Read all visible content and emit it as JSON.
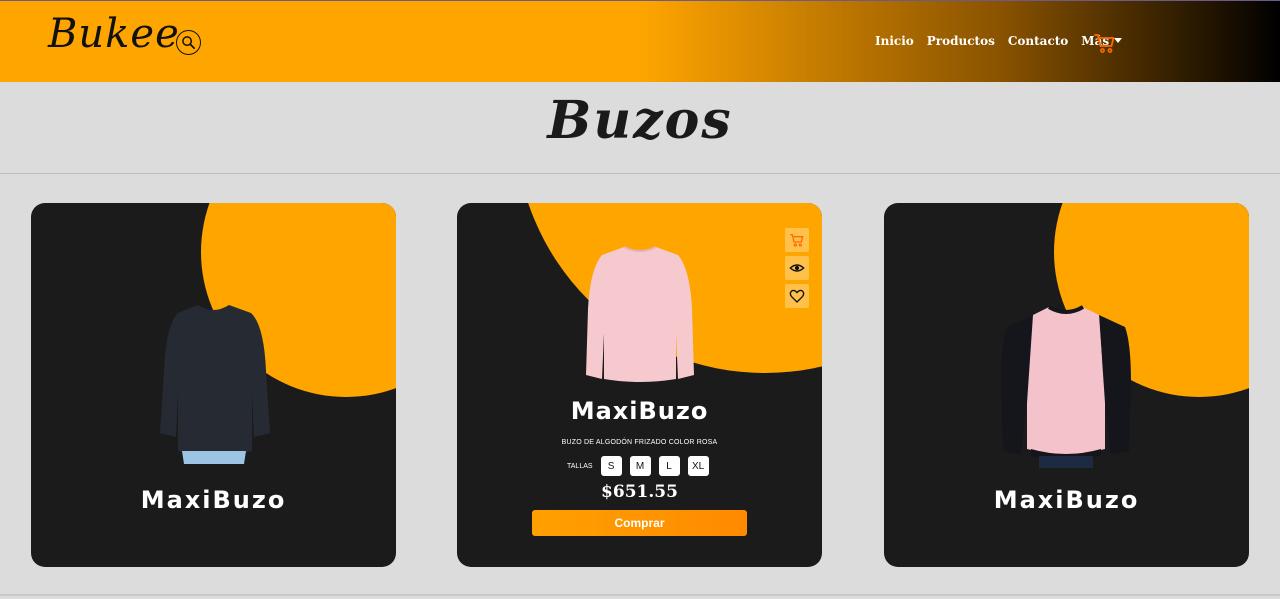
{
  "brand": {
    "logo": "Bukee"
  },
  "nav": {
    "links": [
      "Inicio",
      "Productos",
      "Contacto"
    ],
    "more_label": "Más"
  },
  "page": {
    "title": "Buzos"
  },
  "cards": [
    {
      "name": "MaxiBuzo",
      "sweater_color": "#252a33"
    },
    {
      "name": "MaxiBuzo",
      "description": "BUZO DE ALGODÓN FRIZADO COLOR ROSA",
      "sizes_label": "TALLAS",
      "sizes": [
        "S",
        "M",
        "L",
        "XL"
      ],
      "price": "$651.55",
      "buy_label": "Comprar",
      "sweater_color": "#f6c9cf"
    },
    {
      "name": "MaxiBuzo",
      "sweater_color": "#f3c2cb"
    }
  ],
  "colors": {
    "accent": "#ffa500",
    "card_bg": "#1b1b1b",
    "page_bg": "#dcdcdc",
    "cart_icon": "#ff6a00"
  },
  "icons": [
    "search-icon",
    "cart-icon",
    "eye-icon",
    "heart-icon",
    "chevron-down-icon"
  ]
}
